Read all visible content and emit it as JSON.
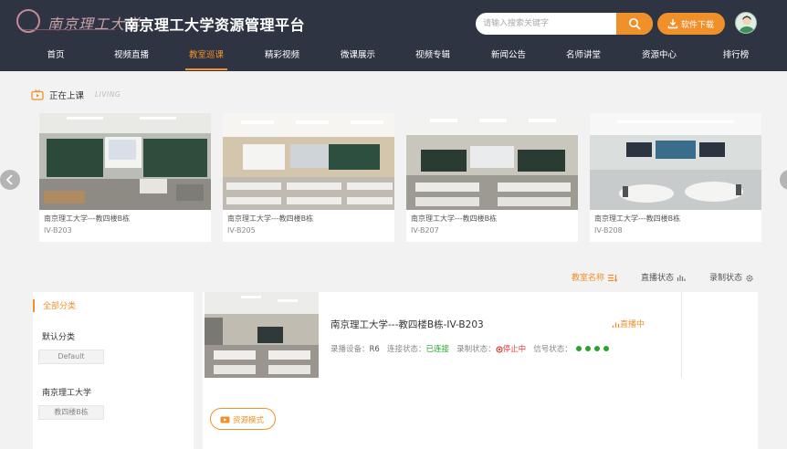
{
  "header": {
    "platform_title": "南京理工大学资源管理平台",
    "search_placeholder": "请输入搜索关键字",
    "download_label": "软件下载"
  },
  "nav": {
    "items": [
      {
        "label": "首页",
        "active": false
      },
      {
        "label": "视频直播",
        "active": false
      },
      {
        "label": "教室巡课",
        "active": true
      },
      {
        "label": "精彩视频",
        "active": false
      },
      {
        "label": "微课展示",
        "active": false
      },
      {
        "label": "视频专辑",
        "active": false
      },
      {
        "label": "新闻公告",
        "active": false
      },
      {
        "label": "名师讲堂",
        "active": false
      },
      {
        "label": "资源中心",
        "active": false
      },
      {
        "label": "排行榜",
        "active": false
      }
    ]
  },
  "live": {
    "title": "正在上课",
    "subtitle": "LIVING",
    "cards": [
      {
        "name": "南京理工大学---教四楼B栋",
        "room": "IV-B203"
      },
      {
        "name": "南京理工大学---教四楼B栋",
        "room": "IV-B205"
      },
      {
        "name": "南京理工大学---教四楼B栋",
        "room": "IV-B207"
      },
      {
        "name": "南京理工大学---教四楼B栋",
        "room": "IV-B208"
      }
    ]
  },
  "sort": {
    "name": "教室名称",
    "live_status": "直播状态",
    "record_status": "录制状态"
  },
  "sidebar": {
    "all_label": "全部分类",
    "groups": [
      {
        "title": "默认分类",
        "tag": "Default"
      },
      {
        "title": "南京理工大学",
        "tag": "教四楼B栋"
      }
    ]
  },
  "room": {
    "title": "南京理工大学---教四楼B栋-IV-B203",
    "live_badge": "直播中",
    "device_label": "录播设备：",
    "device_value": "R6",
    "connect_label": "连接状态：",
    "connect_value": "已连接",
    "record_label": "录制状态：",
    "record_value": "停止中",
    "signal_label": "信号状态：",
    "resource_btn": "资源模式"
  },
  "colors": {
    "accent": "#f0902a",
    "header_bg": "#2f3442",
    "ok": "#2aa32a",
    "stop": "#e03a3a"
  }
}
